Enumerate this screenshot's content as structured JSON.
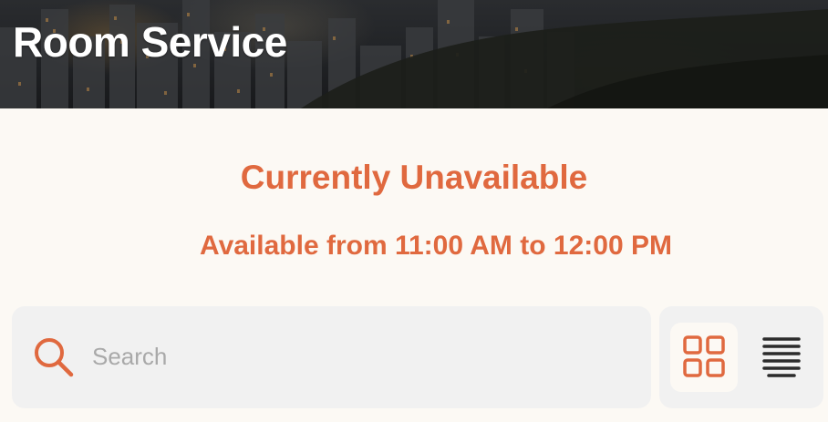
{
  "header": {
    "title": "Room Service"
  },
  "status": {
    "title": "Currently Unavailable",
    "availability": "Available from 11:00 AM to 12:00 PM"
  },
  "search": {
    "placeholder": "Search",
    "value": ""
  },
  "view_toggle": {
    "selected": "grid",
    "options": [
      "grid",
      "list"
    ]
  },
  "icons": {
    "search": "search-icon",
    "grid": "grid-view-icon",
    "list": "list-view-icon"
  },
  "colors": {
    "accent": "#e0693f",
    "background": "#fcf9f4",
    "control_background": "#f1f1f1",
    "placeholder": "#a9a9a9",
    "list_icon": "#2b2b2b"
  }
}
